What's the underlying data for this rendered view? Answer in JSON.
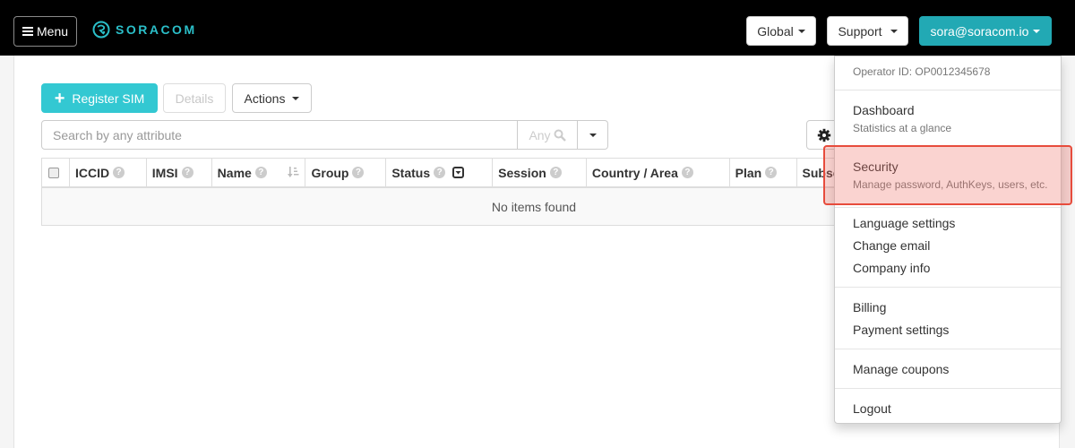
{
  "navbar": {
    "menu_label": "Menu",
    "logo_text": "SORACOM",
    "global_label": "Global",
    "support_label": "Support",
    "user_label": "sora@soracom.io"
  },
  "toolbar": {
    "register_label": "Register SIM",
    "details_label": "Details",
    "actions_label": "Actions"
  },
  "search": {
    "placeholder": "Search by any attribute",
    "value": "",
    "scope_label": "Any"
  },
  "table": {
    "columns": [
      {
        "label": "ICCID",
        "help": true
      },
      {
        "label": "IMSI",
        "help": true
      },
      {
        "label": "Name",
        "help": true,
        "sortable": true
      },
      {
        "label": "Group",
        "help": true
      },
      {
        "label": "Status",
        "help": true,
        "filter": true
      },
      {
        "label": "Session",
        "help": true
      },
      {
        "label": "Country / Area",
        "help": true
      },
      {
        "label": "Plan",
        "help": true
      },
      {
        "label": "Subscription",
        "help": false
      }
    ],
    "empty_text": "No items found"
  },
  "user_menu": {
    "operator_id": "Operator ID: OP0012345678",
    "items": [
      {
        "label": "Dashboard",
        "sub": "Statistics at a glance"
      },
      {
        "label": "Security",
        "sub": "Manage password, AuthKeys, users, etc.",
        "highlighted": true
      },
      {
        "label": "Language settings"
      },
      {
        "label": "Change email"
      },
      {
        "label": "Company info"
      },
      {
        "label": "Billing"
      },
      {
        "label": "Payment settings"
      },
      {
        "label": "Manage coupons"
      },
      {
        "label": "Logout"
      }
    ]
  },
  "colors": {
    "brand": "#2bbfc9",
    "primary_button": "#33c8d2",
    "user_button": "#22a9b4",
    "highlight_border": "#e74c3c"
  }
}
